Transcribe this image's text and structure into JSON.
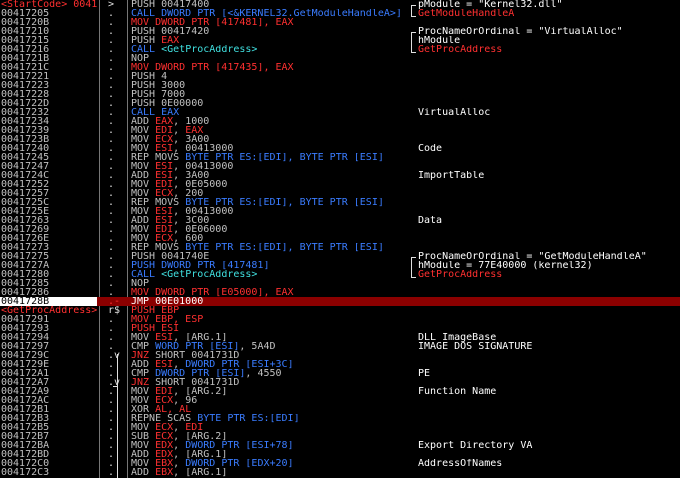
{
  "listing": {
    "rows": [
      {
        "addr": "<StartCode> 0041",
        "addr_label": true,
        "mark": ">",
        "ins": [
          {
            "t": "PUSH 00417400",
            "c": ""
          }
        ],
        "cmt": [
          {
            "t": "pModule = \"Kernel32.dll\"",
            "c": "wh"
          }
        ]
      },
      {
        "addr": "00417205",
        "mark": ".",
        "ins": [
          {
            "t": "CALL DWORD PTR [<&KERNEL32.GetModuleHandleA>]",
            "c": "bl"
          }
        ],
        "cmt": [
          {
            "t": "GetModuleHandleA",
            "c": "rd"
          }
        ]
      },
      {
        "addr": "0041720B",
        "mark": ".",
        "ins": [
          {
            "t": "MOV DWORD PTR [417481], EAX",
            "c": "rd"
          }
        ],
        "cmt": []
      },
      {
        "addr": "00417210",
        "mark": ".",
        "ins": [
          {
            "t": "PUSH 00417420",
            "c": ""
          }
        ],
        "cmt": [
          {
            "t": "ProcNameOrOrdinal = \"VirtualAlloc\"",
            "c": "wh"
          }
        ]
      },
      {
        "addr": "00417215",
        "mark": ".",
        "ins": [
          {
            "t": "PUSH ",
            "c": ""
          },
          {
            "t": "EAX",
            "c": "rd"
          }
        ],
        "cmt": [
          {
            "t": "hModule",
            "c": "wh"
          }
        ]
      },
      {
        "addr": "00417216",
        "mark": ".",
        "ins": [
          {
            "t": "CALL ",
            "c": "bl"
          },
          {
            "t": "<GetProcAddress>",
            "c": "cy"
          }
        ],
        "cmt": [
          {
            "t": "GetProcAddress",
            "c": "rd"
          }
        ]
      },
      {
        "addr": "0041721B",
        "mark": ".",
        "ins": [
          {
            "t": "NOP",
            "c": ""
          }
        ],
        "cmt": []
      },
      {
        "addr": "0041721C",
        "mark": ".",
        "ins": [
          {
            "t": "MOV DWORD PTR [417435], EAX",
            "c": "rd"
          }
        ],
        "cmt": []
      },
      {
        "addr": "00417221",
        "mark": ".",
        "ins": [
          {
            "t": "PUSH 4",
            "c": ""
          }
        ],
        "cmt": []
      },
      {
        "addr": "00417223",
        "mark": ".",
        "ins": [
          {
            "t": "PUSH 3000",
            "c": ""
          }
        ],
        "cmt": []
      },
      {
        "addr": "00417228",
        "mark": ".",
        "ins": [
          {
            "t": "PUSH 7000",
            "c": ""
          }
        ],
        "cmt": []
      },
      {
        "addr": "0041722D",
        "mark": ".",
        "ins": [
          {
            "t": "PUSH 0E00000",
            "c": ""
          }
        ],
        "cmt": []
      },
      {
        "addr": "00417232",
        "mark": ".",
        "ins": [
          {
            "t": "CALL EAX",
            "c": "bl"
          }
        ],
        "cmt": [
          {
            "t": "VirtualAlloc",
            "c": "wh"
          }
        ]
      },
      {
        "addr": "00417234",
        "mark": ".",
        "ins": [
          {
            "t": "ADD ",
            "c": ""
          },
          {
            "t": "EAX",
            "c": "rd"
          },
          {
            "t": ", 1000",
            "c": ""
          }
        ],
        "cmt": []
      },
      {
        "addr": "00417239",
        "mark": ".",
        "ins": [
          {
            "t": "MOV ",
            "c": ""
          },
          {
            "t": "EDI",
            "c": "rd"
          },
          {
            "t": ", ",
            "c": ""
          },
          {
            "t": "EAX",
            "c": "rd"
          }
        ],
        "cmt": []
      },
      {
        "addr": "0041723B",
        "mark": ".",
        "ins": [
          {
            "t": "MOV ",
            "c": ""
          },
          {
            "t": "ECX",
            "c": "rd"
          },
          {
            "t": ", 3A00",
            "c": ""
          }
        ],
        "cmt": []
      },
      {
        "addr": "00417240",
        "mark": ".",
        "ins": [
          {
            "t": "MOV ",
            "c": ""
          },
          {
            "t": "ESI",
            "c": "rd"
          },
          {
            "t": ", 00413000",
            "c": ""
          }
        ],
        "cmt": [
          {
            "t": "Code",
            "c": "wh"
          }
        ]
      },
      {
        "addr": "00417245",
        "mark": ".",
        "ins": [
          {
            "t": "REP MOVS ",
            "c": ""
          },
          {
            "t": "BYTE PTR ES:[EDI], BYTE PTR [ESI]",
            "c": "bl"
          }
        ],
        "cmt": []
      },
      {
        "addr": "00417247",
        "mark": ".",
        "ins": [
          {
            "t": "MOV ",
            "c": ""
          },
          {
            "t": "ESI",
            "c": "rd"
          },
          {
            "t": ", 00413000",
            "c": ""
          }
        ],
        "cmt": []
      },
      {
        "addr": "0041724C",
        "mark": ".",
        "ins": [
          {
            "t": "ADD ",
            "c": ""
          },
          {
            "t": "ESI",
            "c": "rd"
          },
          {
            "t": ", 3A00",
            "c": ""
          }
        ],
        "cmt": [
          {
            "t": "ImportTable",
            "c": "wh"
          }
        ]
      },
      {
        "addr": "00417252",
        "mark": ".",
        "ins": [
          {
            "t": "MOV ",
            "c": ""
          },
          {
            "t": "EDI",
            "c": "rd"
          },
          {
            "t": ", 0E05000",
            "c": ""
          }
        ],
        "cmt": []
      },
      {
        "addr": "00417257",
        "mark": ".",
        "ins": [
          {
            "t": "MOV ",
            "c": ""
          },
          {
            "t": "ECX",
            "c": "rd"
          },
          {
            "t": ", 200",
            "c": ""
          }
        ],
        "cmt": []
      },
      {
        "addr": "0041725C",
        "mark": ".",
        "ins": [
          {
            "t": "REP MOVS ",
            "c": ""
          },
          {
            "t": "BYTE PTR ES:[EDI], BYTE PTR [ESI]",
            "c": "bl"
          }
        ],
        "cmt": []
      },
      {
        "addr": "0041725E",
        "mark": ".",
        "ins": [
          {
            "t": "MOV ",
            "c": ""
          },
          {
            "t": "ESI",
            "c": "rd"
          },
          {
            "t": ", 00413000",
            "c": ""
          }
        ],
        "cmt": []
      },
      {
        "addr": "00417263",
        "mark": ".",
        "ins": [
          {
            "t": "ADD ",
            "c": ""
          },
          {
            "t": "ESI",
            "c": "rd"
          },
          {
            "t": ", 3C00",
            "c": ""
          }
        ],
        "cmt": [
          {
            "t": "Data",
            "c": "wh"
          }
        ]
      },
      {
        "addr": "00417269",
        "mark": ".",
        "ins": [
          {
            "t": "MOV ",
            "c": ""
          },
          {
            "t": "EDI",
            "c": "rd"
          },
          {
            "t": ", 0E06000",
            "c": ""
          }
        ],
        "cmt": []
      },
      {
        "addr": "0041726E",
        "mark": ".",
        "ins": [
          {
            "t": "MOV ",
            "c": ""
          },
          {
            "t": "ECX",
            "c": "rd"
          },
          {
            "t": ", 600",
            "c": ""
          }
        ],
        "cmt": []
      },
      {
        "addr": "00417273",
        "mark": ".",
        "ins": [
          {
            "t": "REP MOVS ",
            "c": ""
          },
          {
            "t": "BYTE PTR ES:[EDI], BYTE PTR [ESI]",
            "c": "bl"
          }
        ],
        "cmt": []
      },
      {
        "addr": "00417275",
        "mark": ".",
        "ins": [
          {
            "t": "PUSH 0041740E",
            "c": ""
          }
        ],
        "cmt": [
          {
            "t": "ProcNameOrOrdinal = \"GetModuleHandleA\"",
            "c": "wh"
          }
        ]
      },
      {
        "addr": "0041727A",
        "mark": ".",
        "ins": [
          {
            "t": "PUSH DWORD PTR [417481]",
            "c": "bl"
          }
        ],
        "cmt": [
          {
            "t": "hModule = 77E40000 (kernel32)",
            "c": "wh"
          }
        ]
      },
      {
        "addr": "00417280",
        "mark": ".",
        "ins": [
          {
            "t": "CALL ",
            "c": "bl"
          },
          {
            "t": "<GetProcAddress>",
            "c": "cy"
          }
        ],
        "cmt": [
          {
            "t": "GetProcAddress",
            "c": "rd"
          }
        ]
      },
      {
        "addr": "00417285",
        "mark": ".",
        "ins": [
          {
            "t": "NOP",
            "c": ""
          }
        ],
        "cmt": []
      },
      {
        "addr": "00417286",
        "mark": ".",
        "ins": [
          {
            "t": "MOV DWORD PTR [E05000], EAX",
            "c": "rd"
          }
        ],
        "cmt": []
      },
      {
        "addr": "0041728B",
        "mark": ".-",
        "mark_red": true,
        "selected": true,
        "current": true,
        "ins": [
          {
            "t": "JMP 00E01000",
            "c": "wh"
          }
        ],
        "cmt": []
      },
      {
        "addr": "<GetProcAddress>",
        "addr_label": true,
        "mark": "r$",
        "ins": [
          {
            "t": "PUSH EBP",
            "c": "rd"
          }
        ],
        "cmt": []
      },
      {
        "addr": "00417291",
        "mark": ".",
        "ins": [
          {
            "t": "MOV EBP, ESP",
            "c": "rd"
          }
        ],
        "cmt": []
      },
      {
        "addr": "00417293",
        "mark": ".",
        "ins": [
          {
            "t": "PUSH ESI",
            "c": "rd"
          }
        ],
        "cmt": []
      },
      {
        "addr": "00417294",
        "mark": ".",
        "ins": [
          {
            "t": "MOV ",
            "c": ""
          },
          {
            "t": "ESI",
            "c": "rd"
          },
          {
            "t": ", [ARG.1]",
            "c": ""
          }
        ],
        "cmt": [
          {
            "t": "DLL ImageBase",
            "c": "wh"
          }
        ]
      },
      {
        "addr": "00417297",
        "mark": ".",
        "ins": [
          {
            "t": "CMP ",
            "c": ""
          },
          {
            "t": "WORD PTR [ESI]",
            "c": "bl"
          },
          {
            "t": ", 5A4D",
            "c": ""
          }
        ],
        "cmt": [
          {
            "t": "IMAGE_DOS_SIGNATURE",
            "c": "wh"
          }
        ]
      },
      {
        "addr": "0041729C",
        "mark": ".v",
        "ins": [
          {
            "t": "JNZ ",
            "c": "rd"
          },
          {
            "t": "SHORT 0041731D",
            "c": ""
          }
        ],
        "cmt": []
      },
      {
        "addr": "0041729E",
        "mark": ".",
        "ins": [
          {
            "t": "ADD ",
            "c": ""
          },
          {
            "t": "ESI",
            "c": "rd"
          },
          {
            "t": ", ",
            "c": ""
          },
          {
            "t": "DWORD PTR [ESI+3C]",
            "c": "bl"
          }
        ],
        "cmt": []
      },
      {
        "addr": "004172A1",
        "mark": ".",
        "ins": [
          {
            "t": "CMP ",
            "c": ""
          },
          {
            "t": "DWORD PTR [ESI]",
            "c": "bl"
          },
          {
            "t": ", 4550",
            "c": ""
          }
        ],
        "cmt": [
          {
            "t": "PE",
            "c": "wh"
          }
        ]
      },
      {
        "addr": "004172A7",
        "mark": ".v",
        "ins": [
          {
            "t": "JNZ ",
            "c": "rd"
          },
          {
            "t": "SHORT 0041731D",
            "c": ""
          }
        ],
        "cmt": []
      },
      {
        "addr": "004172A9",
        "mark": ".",
        "ins": [
          {
            "t": "MOV ",
            "c": ""
          },
          {
            "t": "EDI",
            "c": "rd"
          },
          {
            "t": ", [ARG.2]",
            "c": ""
          }
        ],
        "cmt": [
          {
            "t": "Function Name",
            "c": "wh"
          }
        ]
      },
      {
        "addr": "004172AC",
        "mark": ".",
        "ins": [
          {
            "t": "MOV ",
            "c": ""
          },
          {
            "t": "ECX",
            "c": "rd"
          },
          {
            "t": ", 96",
            "c": ""
          }
        ],
        "cmt": []
      },
      {
        "addr": "004172B1",
        "mark": ".",
        "ins": [
          {
            "t": "XOR ",
            "c": ""
          },
          {
            "t": "AL, AL",
            "c": "rd"
          }
        ],
        "cmt": []
      },
      {
        "addr": "004172B3",
        "mark": ".",
        "ins": [
          {
            "t": "REPNE SCAS ",
            "c": ""
          },
          {
            "t": "BYTE PTR ES:[EDI]",
            "c": "bl"
          }
        ],
        "cmt": []
      },
      {
        "addr": "004172B5",
        "mark": ".",
        "ins": [
          {
            "t": "MOV ",
            "c": ""
          },
          {
            "t": "ECX",
            "c": "rd"
          },
          {
            "t": ", ",
            "c": ""
          },
          {
            "t": "EDI",
            "c": "rd"
          }
        ],
        "cmt": []
      },
      {
        "addr": "004172B7",
        "mark": ".",
        "ins": [
          {
            "t": "SUB ",
            "c": ""
          },
          {
            "t": "ECX",
            "c": "rd"
          },
          {
            "t": ", [ARG.2]",
            "c": ""
          }
        ],
        "cmt": []
      },
      {
        "addr": "004172BA",
        "mark": ".",
        "ins": [
          {
            "t": "MOV ",
            "c": ""
          },
          {
            "t": "EDX",
            "c": "rd"
          },
          {
            "t": ", ",
            "c": ""
          },
          {
            "t": "DWORD PTR [ESI+78]",
            "c": "bl"
          }
        ],
        "cmt": [
          {
            "t": "Export Directory VA",
            "c": "wh"
          }
        ]
      },
      {
        "addr": "004172BD",
        "mark": ".",
        "ins": [
          {
            "t": "ADD ",
            "c": ""
          },
          {
            "t": "EDX",
            "c": "rd"
          },
          {
            "t": ", [ARG.1]",
            "c": ""
          }
        ],
        "cmt": []
      },
      {
        "addr": "004172C0",
        "mark": ".",
        "ins": [
          {
            "t": "MOV ",
            "c": ""
          },
          {
            "t": "EBX",
            "c": "rd"
          },
          {
            "t": ", ",
            "c": ""
          },
          {
            "t": "DWORD PTR [EDX+20]",
            "c": "bl"
          }
        ],
        "cmt": [
          {
            "t": "AddressOfNames",
            "c": "wh"
          }
        ]
      },
      {
        "addr": "004172C3",
        "mark": ".",
        "ins": [
          {
            "t": "ADD ",
            "c": ""
          },
          {
            "t": "EBX",
            "c": "rd"
          },
          {
            "t": ", [ARG.1]",
            "c": ""
          }
        ],
        "cmt": []
      }
    ]
  }
}
